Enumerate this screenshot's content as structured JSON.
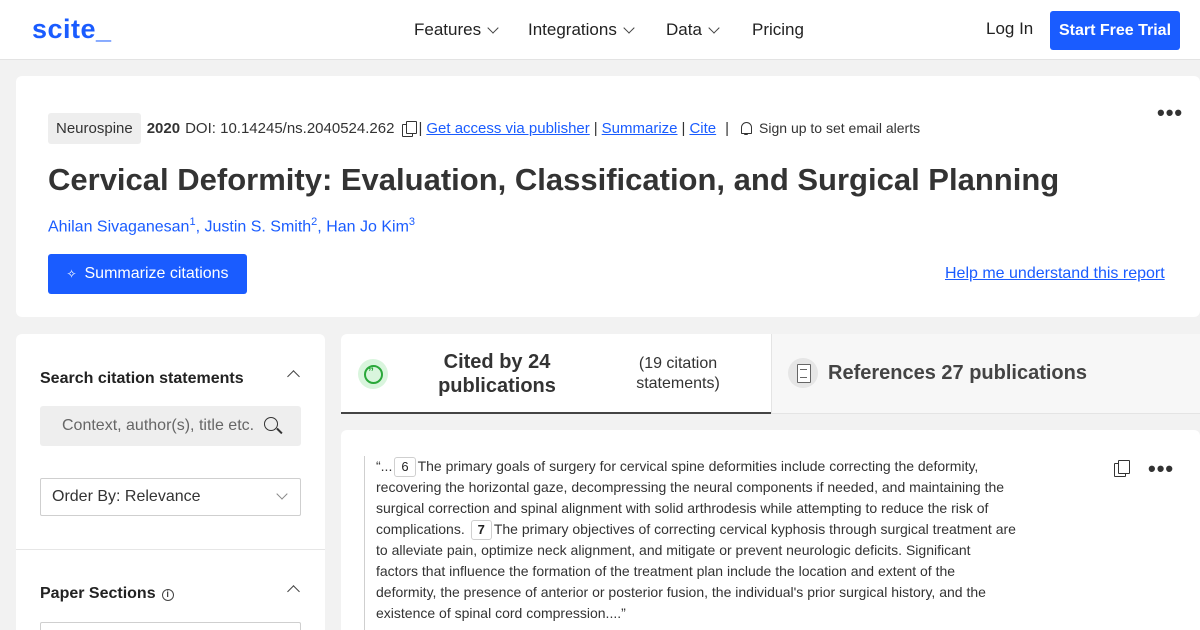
{
  "header": {
    "logo": "scite_",
    "nav": [
      {
        "label": "Features",
        "has_dropdown": true
      },
      {
        "label": "Integrations",
        "has_dropdown": true
      },
      {
        "label": "Data",
        "has_dropdown": true
      },
      {
        "label": "Pricing",
        "has_dropdown": false
      }
    ],
    "login": "Log In",
    "cta": "Start Free Trial"
  },
  "paper": {
    "journal": "Neurospine",
    "year": "2020",
    "doi": "DOI: 10.14245/ns.2040524.262",
    "links": {
      "access": "Get access via publisher",
      "summarize": "Summarize",
      "cite": "Cite"
    },
    "separator": "|",
    "alerts": "Sign up to set email alerts",
    "title": "Cervical Deformity: Evaluation, Classification, and Surgical Planning",
    "authors": [
      {
        "name": "Ahilan Sivaganesan",
        "affil": "1",
        "sep": ","
      },
      {
        "name": "Justin S. Smith",
        "affil": "2",
        "sep": ","
      },
      {
        "name": "Han Jo Kim",
        "affil": "3",
        "sep": ""
      }
    ],
    "summarize_button": "Summarize citations",
    "help_link": "Help me understand this report",
    "more_icon": "kebab-icon"
  },
  "sidebar": {
    "search_heading": "Search citation statements",
    "search_placeholder": "Context, author(s), title etc.",
    "order_by": "Order By: Relevance",
    "sections_heading": "Paper Sections"
  },
  "tabs": {
    "cited_by": "Cited by 24 publications",
    "statements": "(19 citation statements)",
    "references": "References 27 publications"
  },
  "citation": {
    "prefix": "“...",
    "ref1": "6",
    "text1": "The primary goals of surgery for cervical spine deformities include correcting the deformity, recovering the horizontal gaze, decompressing the neural components if needed, and maintaining the surgical correction and spinal alignment with solid arthrodesis while attempting to reduce the risk of complications.",
    "ref2": "7",
    "text2": "The primary objectives of correcting cervical kyphosis through surgical treatment are to alleviate pain, optimize neck alignment, and mitigate or prevent neurologic deficits. Significant factors that influence the formation of the treatment plan include the location and extent of the deformity, the presence of anterior or posterior fusion, the individual's prior surgical history, and the existence of spinal cord compression....”"
  },
  "colors": {
    "brand": "#1a5cff",
    "background": "#f2f2f2",
    "supporting_green": "#2aa83a"
  }
}
